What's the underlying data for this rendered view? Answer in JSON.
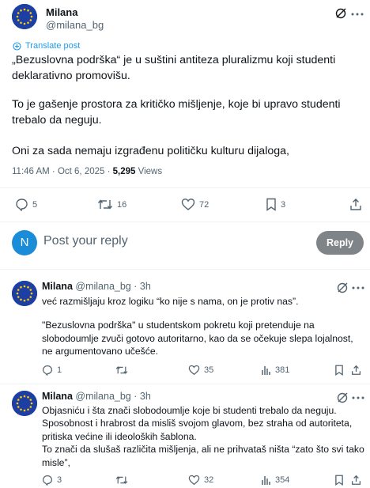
{
  "post": {
    "author_name": "Milana",
    "author_handle": "@milana_bg",
    "translate_label": "Translate post",
    "paragraphs": [
      "„Bezuslovna podrška“ je u suštini antiteza pluralizmu koji studenti deklarativno promovišu.",
      "To je gašenje prostora za kritičko mišljenje, koje bi upravo studenti trebalo da neguju.",
      "Oni za sada nemaju izgrađenu političku kulturu dijaloga,"
    ],
    "time": "11:46 AM · Oct 6, 2025 · ",
    "views_count": "5,295",
    "views_label": " Views",
    "replies": "5",
    "reposts": "16",
    "likes": "72",
    "bookmarks": "3"
  },
  "reply_box": {
    "avatar_letter": "N",
    "placeholder": "Post your reply",
    "button_label": "Reply"
  },
  "replies": [
    {
      "name": "Milana",
      "handle": "@milana_bg",
      "time": " · 3h",
      "lines": [
        "već razmišljaju kroz logiku “ko nije s nama, on je protiv nas”.",
        "",
        "\"Bezuslovna podrška\" u studentskom pokretu koji pretenduje na slobodoumlje zvuči gotovo autoritarno, kao da se očekuje slepa lojalnost, ne argumentovano učešće."
      ],
      "replies": "1",
      "reposts": "",
      "likes": "35",
      "views": "381"
    },
    {
      "name": "Milana",
      "handle": "@milana_bg",
      "time": " · 3h",
      "lines": [
        "Objasniću i šta znači slobodoumlje koje bi studenti trebalo da neguju.",
        "Sposobnost i hrabrost da misliš svojom glavom, bez straha od autoriteta, pritiska većine ili ideoloških šablona.",
        "To znači da slušaš različita mišljenja, ali ne prihvataš ništa “zato što svi tako misle”,"
      ],
      "replies": "3",
      "reposts": "",
      "likes": "32",
      "views": "354"
    }
  ],
  "colors": {
    "accent": "#1d9bf0",
    "secondary_text": "#536471",
    "reply_button": "#7f8489",
    "eu_blue": "#1d3fa3",
    "eu_star": "#ffcc00"
  },
  "icons": [
    "grok-icon",
    "more-icon",
    "translate-icon",
    "reply-icon",
    "repost-icon",
    "like-icon",
    "bookmark-icon",
    "share-icon",
    "views-icon"
  ]
}
